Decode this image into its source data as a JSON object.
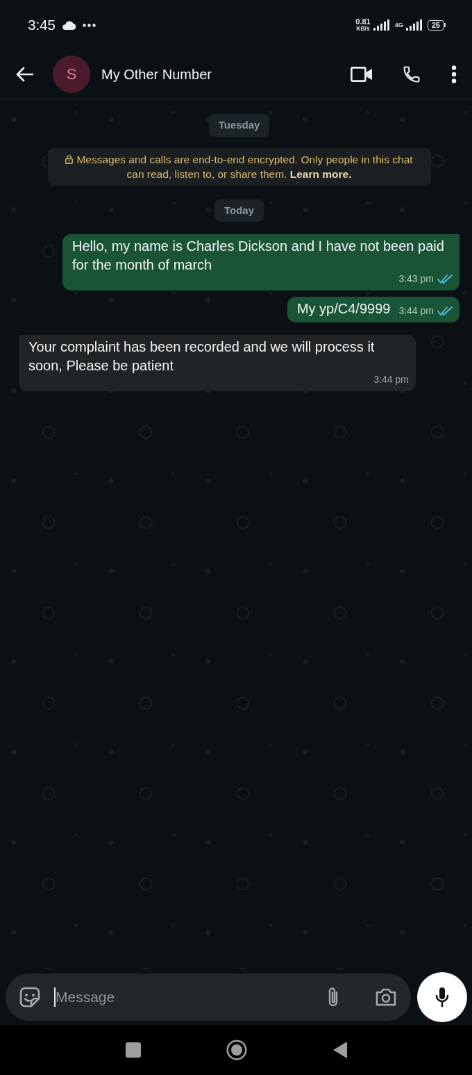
{
  "status_bar": {
    "time": "3:45",
    "network_speed": "0.81",
    "speed_unit": "KB/s",
    "network_type": "4G",
    "battery": "25"
  },
  "header": {
    "avatar_letter": "S",
    "contact_name": "My Other Number"
  },
  "chat": [
    {
      "kind": "date",
      "text": "Tuesday"
    },
    {
      "kind": "notice",
      "text": "Messages and calls are end-to-end encrypted. Only people in this chat can read, listen to, or share them.",
      "link": "Learn more."
    },
    {
      "kind": "date",
      "text": "Today"
    },
    {
      "kind": "outgoing",
      "text": "Hello, my name is Charles Dickson and I have not been paid for the month of march",
      "time": "3:43 pm",
      "read": true
    },
    {
      "kind": "outgoing",
      "text": "My yp/C4/9999",
      "time": "3:44 pm",
      "read": true
    },
    {
      "kind": "incoming",
      "text": "Your complaint has been recorded and we will process it soon, Please be patient",
      "time": "3:44 pm"
    }
  ],
  "composer": {
    "placeholder": "Message"
  }
}
